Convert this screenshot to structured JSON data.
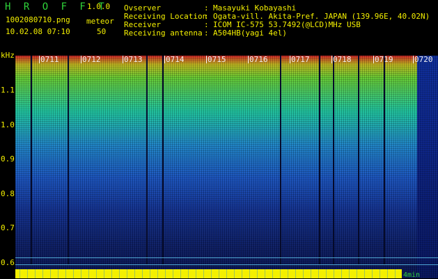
{
  "header": {
    "app_title": "H R O F F T",
    "app_version": "1.0.0",
    "file_name": "1002080710.png",
    "mode_label": "meteor",
    "datetime": "10.02.08 07:10",
    "count": "50",
    "info": [
      {
        "label": "Ovserver",
        "value": "Masayuki Kobayashi"
      },
      {
        "label": "Receiving Location",
        "value": "Ogata-vill. Akita-Pref. JAPAN (139.96E, 40.02N)"
      },
      {
        "label": "Receiver",
        "value": "ICOM IC-575 53.7492(@LCD)MHz USB"
      },
      {
        "label": "Receiving antenna",
        "value": "A504HB(yagi 4el)"
      }
    ]
  },
  "spectrogram": {
    "y_unit": "kHz",
    "y_labels": [
      "1.1",
      "1.0",
      "0.9",
      "0.8",
      "0.7",
      "0.6"
    ],
    "minutes": [
      "0711",
      "0712",
      "0713",
      "0714",
      "0715",
      "0716",
      "0717",
      "0718",
      "0719",
      "0720"
    ],
    "bottom_note": "4min"
  },
  "colors": {
    "text_yellow": "#f4f000",
    "text_green": "#2fd43a",
    "reference_lines": "#66d5ff"
  }
}
